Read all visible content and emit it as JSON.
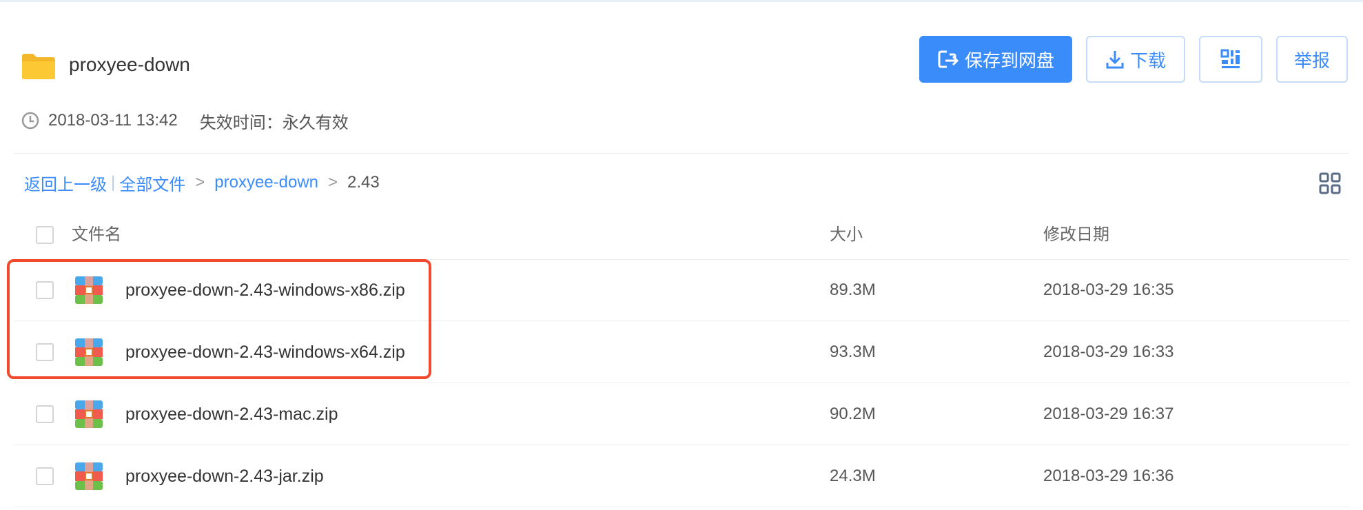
{
  "share": {
    "folder_name": "proxyee-down",
    "created": "2018-03-11 13:42",
    "expire": "失效时间：永久有效"
  },
  "actions": {
    "save_label": "保存到网盘",
    "download_label": "下载",
    "report_label": "举报"
  },
  "breadcrumb": {
    "back": "返回上一级",
    "divider": "|",
    "all_files": "全部文件",
    "sep": ">",
    "folder": "proxyee-down",
    "current": "2.43"
  },
  "table": {
    "headers": {
      "name": "文件名",
      "size": "大小",
      "date": "修改日期"
    },
    "rows": [
      {
        "name": "proxyee-down-2.43-windows-x86.zip",
        "size": "89.3M",
        "date": "2018-03-29 16:35"
      },
      {
        "name": "proxyee-down-2.43-windows-x64.zip",
        "size": "93.3M",
        "date": "2018-03-29 16:33"
      },
      {
        "name": "proxyee-down-2.43-mac.zip",
        "size": "90.2M",
        "date": "2018-03-29 16:37"
      },
      {
        "name": "proxyee-down-2.43-jar.zip",
        "size": "24.3M",
        "date": "2018-03-29 16:36"
      }
    ]
  },
  "colors": {
    "accent": "#3b8cfb",
    "highlight": "#f1492c",
    "folder": "#fcc934"
  },
  "icons": [
    "folder-icon",
    "save-icon",
    "download-icon",
    "qrcode-icon",
    "clock-icon",
    "grid-view-icon",
    "zip-file-icon"
  ]
}
